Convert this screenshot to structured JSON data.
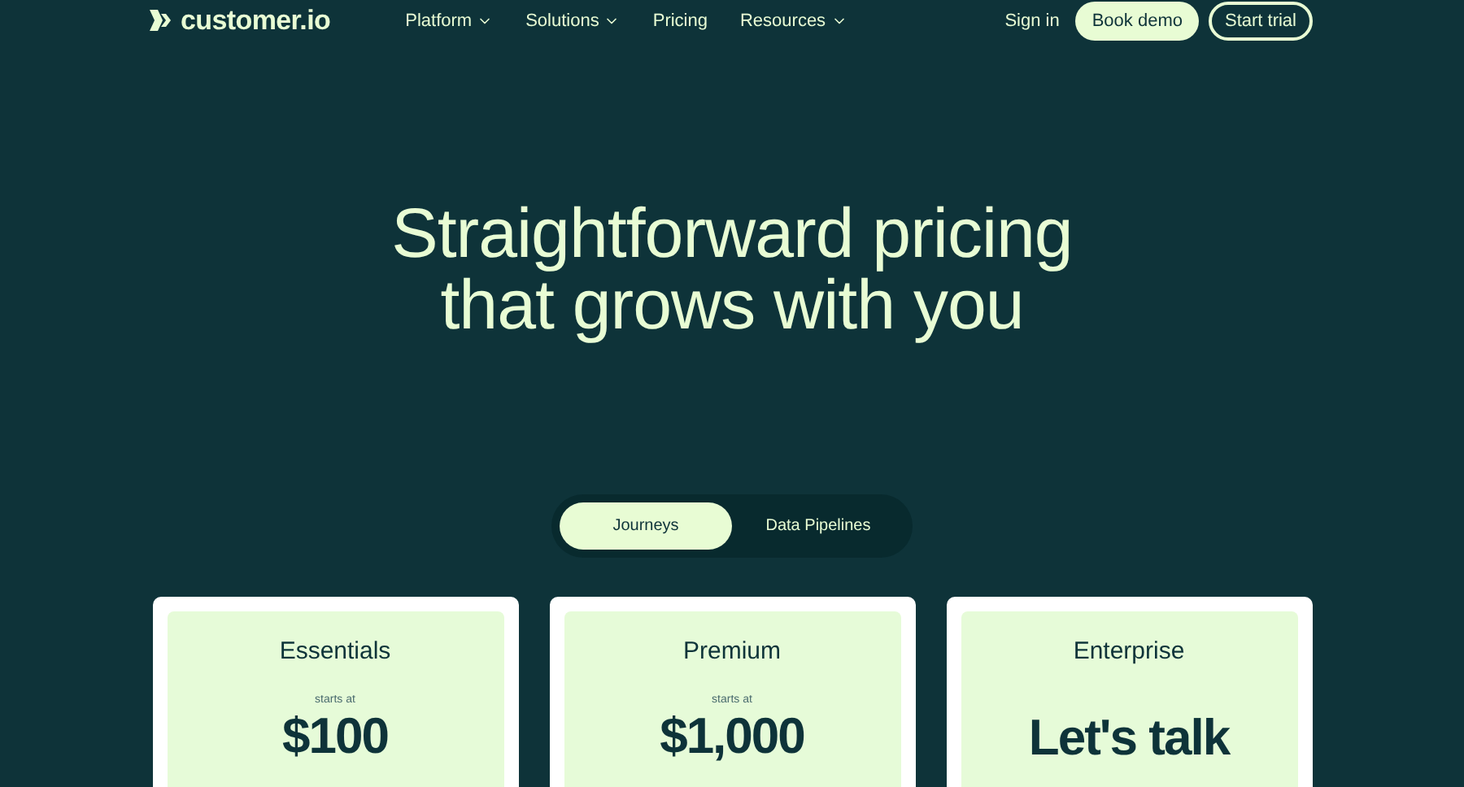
{
  "header": {
    "logo": "customer.io",
    "nav": [
      {
        "label": "Platform",
        "dropdown": true
      },
      {
        "label": "Solutions",
        "dropdown": true
      },
      {
        "label": "Pricing",
        "dropdown": false
      },
      {
        "label": "Resources",
        "dropdown": true
      }
    ],
    "sign_in": "Sign in",
    "book_demo": "Book demo",
    "start_trial": "Start trial"
  },
  "hero": {
    "title_lines": [
      "Straightforward pricing",
      "that grows with you"
    ]
  },
  "tabs": [
    {
      "label": "Journeys",
      "selected": true
    },
    {
      "label": "Data Pipelines",
      "selected": false
    }
  ],
  "plans": [
    {
      "name": "Essentials",
      "prefix": "starts at",
      "price": "$100"
    },
    {
      "name": "Premium",
      "prefix": "starts at",
      "price": "$1,000"
    },
    {
      "name": "Enterprise",
      "price": "Let's talk"
    }
  ]
}
